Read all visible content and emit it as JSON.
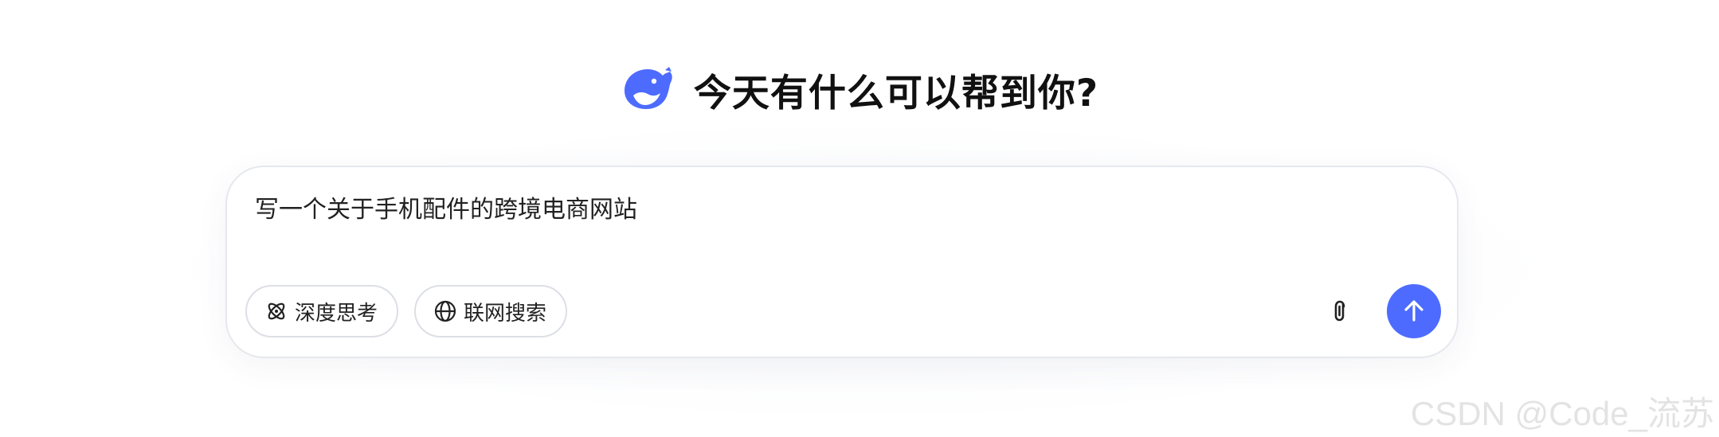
{
  "header": {
    "logo_icon": "deepseek-whale-icon",
    "greeting": "今天有什么可以帮到你?"
  },
  "input": {
    "value": "写一个关于手机配件的跨境电商网站"
  },
  "toolbar": {
    "deep_think": {
      "icon": "atom-icon",
      "label": "深度思考"
    },
    "web_search": {
      "icon": "globe-icon",
      "label": "联网搜索"
    },
    "attach_icon": "paperclip-icon",
    "send_icon": "arrow-up-icon"
  },
  "watermark": "CSDN @Code_流苏",
  "colors": {
    "accent": "#4d6bfe",
    "border": "#e6e8ee",
    "text": "#111111"
  }
}
